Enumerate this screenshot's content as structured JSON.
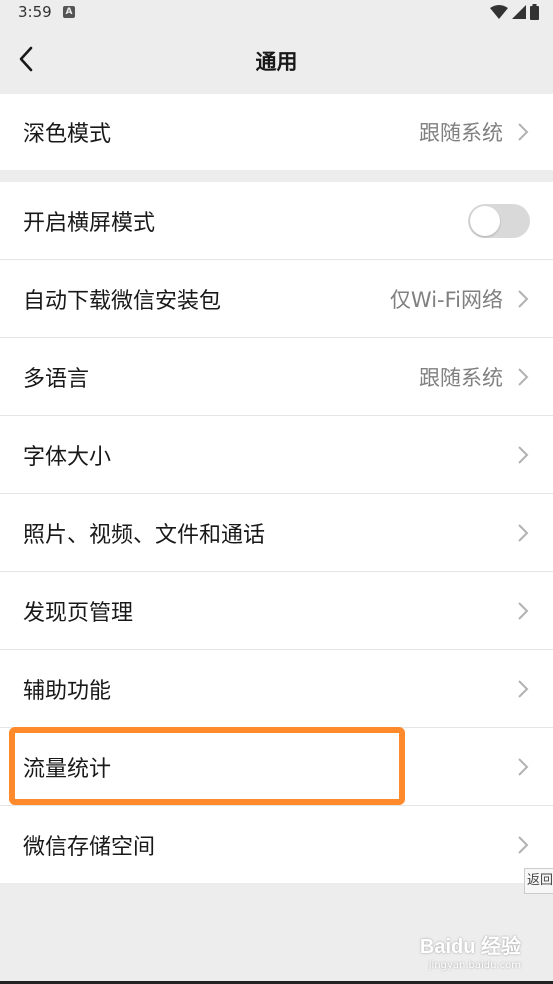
{
  "status_bar": {
    "time": "3:59",
    "notification_badge": "A"
  },
  "nav": {
    "title": "通用"
  },
  "sections": {
    "dark_mode": {
      "label": "深色模式",
      "value": "跟随系统"
    },
    "landscape": {
      "label": "开启横屏模式",
      "toggle_on": false
    },
    "auto_download": {
      "label": "自动下载微信安装包",
      "value": "仅Wi-Fi网络"
    },
    "language": {
      "label": "多语言",
      "value": "跟随系统"
    },
    "font_size": {
      "label": "字体大小"
    },
    "media": {
      "label": "照片、视频、文件和通话"
    },
    "discover": {
      "label": "发现页管理"
    },
    "accessibility": {
      "label": "辅助功能"
    },
    "data_usage": {
      "label": "流量统计"
    },
    "storage": {
      "label": "微信存储空间"
    }
  },
  "float_button": {
    "label": "返回"
  },
  "watermark": {
    "brand": "Baidu 经验",
    "url": "jingyan.baidu.com"
  },
  "colors": {
    "background": "#ededed",
    "highlight": "#ff8a2b",
    "toggle_off": "#d9d9d9"
  }
}
